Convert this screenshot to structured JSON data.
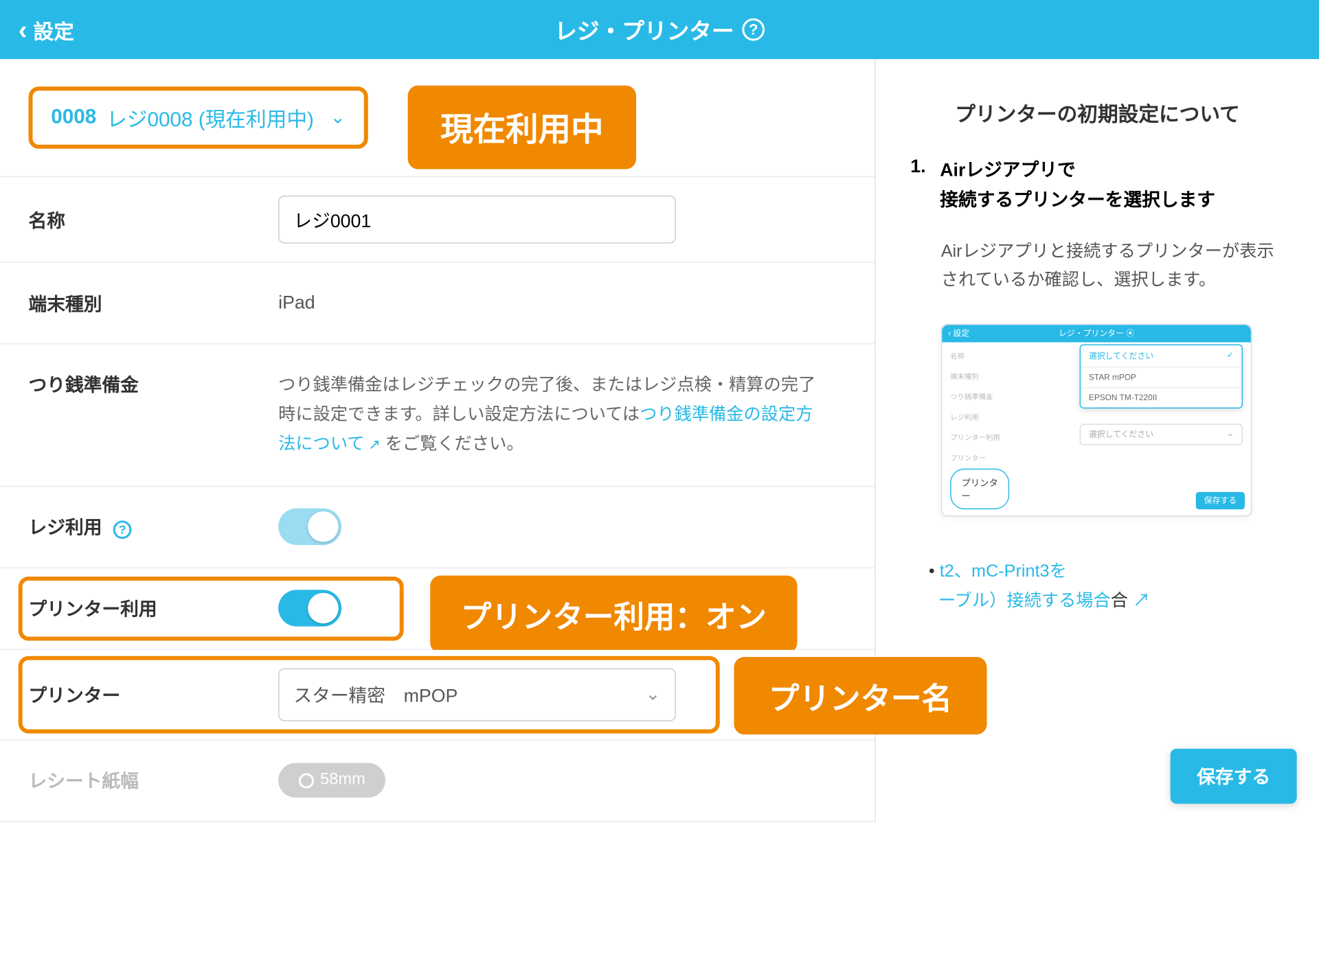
{
  "header": {
    "back_label": "設定",
    "title": "レジ・プリンター"
  },
  "selector": {
    "number": "0008",
    "name": "レジ0008",
    "status": "(現在利用中)"
  },
  "annotations": {
    "currently_using": "現在利用中",
    "printer_use_on": "プリンター利用：オン",
    "printer_name": "プリンター名"
  },
  "rows": {
    "name_label": "名称",
    "name_value": "レジ0001",
    "device_label": "端末種別",
    "device_value": "iPad",
    "change_fund_label": "つり銭準備金",
    "change_fund_text_1": "つり銭準備金はレジチェックの完了後、またはレジ点検・精算の完了時に設定できます。詳しい設定方法については",
    "change_fund_link": "つり銭準備金の設定方法について",
    "change_fund_text_2": " をご覧ください。",
    "register_use_label": "レジ利用",
    "printer_use_label": "プリンター利用",
    "printer_label": "プリンター",
    "printer_selected": "スター精密　mPOP",
    "receipt_width_label": "レシート紙幅",
    "receipt_width_value": "58mm"
  },
  "side": {
    "title": "プリンターの初期設定について",
    "step_num": "1.",
    "step_title": "Airレジアプリで\n接続するプリンターを選択します",
    "step_desc": "Airレジアプリと接続するプリンターが表示されているか確認し、選択します。",
    "mock": {
      "header_back": "設定",
      "header_title": "レジ・プリンター ⦿",
      "left_items": [
        "名称",
        "端末種別",
        "つり銭準備金",
        "レジ利用",
        "プリンター利用",
        "プリンター"
      ],
      "dropdown_placeholder": "選択してください",
      "dropdown_opt1": "STAR mPOP",
      "dropdown_opt2": "EPSON TM-T220II",
      "select2_placeholder": "選択してください",
      "printer_badge": "プリンター",
      "save": "保存する"
    },
    "link_text_1": "t2、mC-Print3を",
    "link_text_2": "ーブル）接続する場合",
    "save_button": "保存する"
  }
}
